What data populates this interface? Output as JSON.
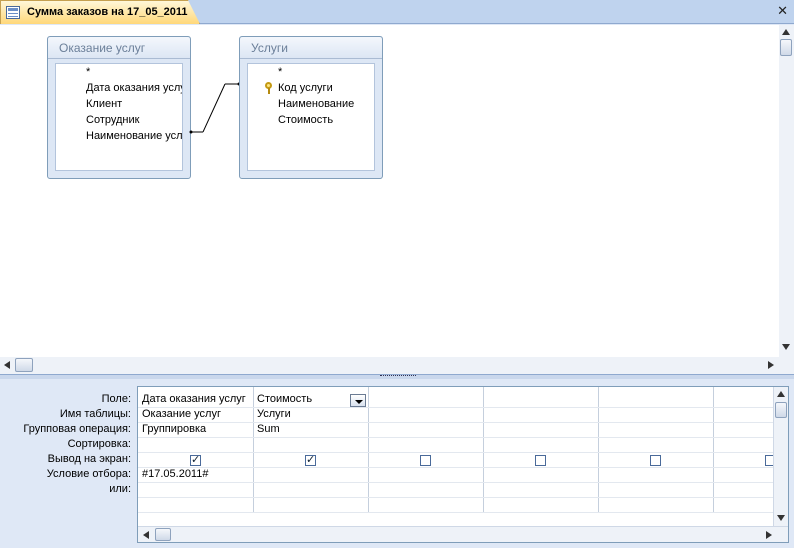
{
  "window": {
    "title": "Сумма заказов на 17_05_2011"
  },
  "tables": [
    {
      "name": "Оказание услуг",
      "fields": [
        "*",
        "Дата оказания услуг",
        "Клиент",
        "Сотрудник",
        "Наименование услуги"
      ]
    },
    {
      "name": "Услуги",
      "fields": [
        "*",
        "Код услуги",
        "Наименование",
        "Стоимость"
      ],
      "key_field_index": 1
    }
  ],
  "grid": {
    "row_labels": [
      "Поле:",
      "Имя таблицы:",
      "Групповая операция:",
      "Сортировка:",
      "Вывод на экран:",
      "Условие отбора:",
      "или:"
    ],
    "columns": [
      {
        "field": "Дата оказания услуг",
        "table": "Оказание услуг",
        "group": "Группировка",
        "sort": "",
        "show": true,
        "criteria": "#17.05.2011#"
      },
      {
        "field": "Стоимость",
        "table": "Услуги",
        "group": "Sum",
        "sort": "",
        "show": true,
        "criteria": ""
      },
      {
        "field": "",
        "table": "",
        "group": "",
        "sort": "",
        "show": false,
        "criteria": ""
      },
      {
        "field": "",
        "table": "",
        "group": "",
        "sort": "",
        "show": false,
        "criteria": ""
      },
      {
        "field": "",
        "table": "",
        "group": "",
        "sort": "",
        "show": false,
        "criteria": ""
      },
      {
        "field": "",
        "table": "",
        "group": "",
        "sort": "",
        "show": false,
        "criteria": ""
      }
    ]
  },
  "colors": {
    "tab_accent": "#ffd87a",
    "pane_bg": "#dfe8f6",
    "border": "#7f9db9"
  },
  "icons": [
    "query-icon",
    "close-icon",
    "primary-key-icon",
    "dropdown-icon",
    "scroll-arrow-icon",
    "checkbox-icon"
  ]
}
